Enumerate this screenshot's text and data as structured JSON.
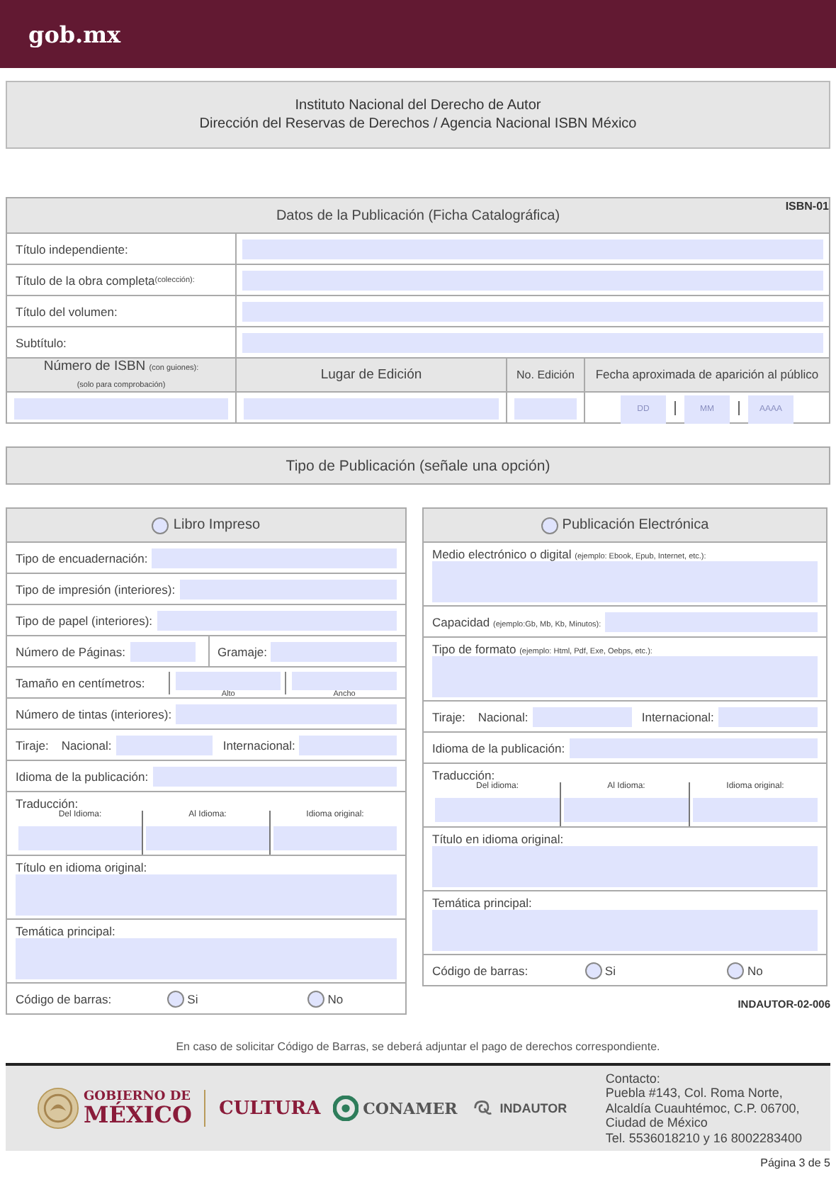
{
  "header": {
    "brand": "gob.mx"
  },
  "institution": {
    "lines": [
      "Instituto Nacional del Derecho de Autor",
      "Dirección del Reservas de Derechos / Agencia Nacional ISBN México"
    ]
  },
  "publication_data": {
    "title": "Datos de la Publicación (Ficha Catalográfica)",
    "form_code": "ISBN-01",
    "fields": [
      {
        "label": "Título independiente:"
      },
      {
        "label": "Título de la obra completa",
        "note": "(colección):"
      },
      {
        "label": "Título del volumen:"
      },
      {
        "label": "Subtítulo:"
      }
    ],
    "columns": [
      {
        "label": "Número de ISBN",
        "note": "(con guiones):",
        "subnote": "(solo para comprobación)"
      },
      {
        "label": "Lugar de Edición"
      },
      {
        "label": "No. Edición"
      },
      {
        "label": "Fecha aproximada de aparición al público"
      }
    ],
    "date_placeholders": [
      "DD",
      "MM",
      "AAAA"
    ]
  },
  "type_section": {
    "title": "Tipo de Publicación (señale una opción)"
  },
  "publication_types": [
    {
      "title": "Libro Impreso",
      "selected": false,
      "rows": [
        {
          "kind": "field",
          "label": "Tipo de encuadernación:"
        },
        {
          "kind": "field",
          "label": "Tipo de impresión (interiores):"
        },
        {
          "kind": "field",
          "label": "Tipo de papel (interiores):"
        },
        {
          "kind": "pair",
          "items": [
            "Número de Páginas:",
            "Gramaje:"
          ]
        },
        {
          "kind": "size",
          "label": "Tamaño en centímetros:",
          "items": [
            "Alto",
            "Ancho"
          ]
        },
        {
          "kind": "field",
          "label": "Número de tintas (interiores):"
        },
        {
          "kind": "multi",
          "label": "Tiraje:",
          "items": [
            "Nacional:",
            "Internacional:"
          ]
        },
        {
          "kind": "field",
          "label": "Idioma de la publicación:"
        },
        {
          "kind": "columns",
          "label": "Traducción:",
          "items": [
            "Del Idioma:",
            "Al Idioma:",
            "Idioma original:"
          ]
        },
        {
          "kind": "area",
          "label": "Título en idioma original:"
        },
        {
          "kind": "area",
          "label": "Temática principal:"
        },
        {
          "kind": "radio",
          "label": "Código de barras:",
          "options": [
            {
              "label": "Si",
              "selected": false
            },
            {
              "label": "No",
              "selected": false
            }
          ]
        }
      ]
    },
    {
      "title": "Publicación Electrónica",
      "selected": false,
      "rows": [
        {
          "kind": "area",
          "label": "Medio electrónico o digital",
          "note": "(ejemplo: Ebook, Epub, Internet, etc.):"
        },
        {
          "kind": "field",
          "label": "Capacidad",
          "note": "(ejemplo:Gb, Mb, Kb, Minutos):"
        },
        {
          "kind": "area",
          "label": "Tipo de formato",
          "note": "(ejemplo: Html, Pdf, Exe, Oebps, etc.):"
        },
        {
          "kind": "multi",
          "label": "Tiraje:",
          "items": [
            "Nacional:",
            "Internacional:"
          ]
        },
        {
          "kind": "field",
          "label": "Idioma de la publicación:"
        },
        {
          "kind": "columns",
          "label": "Traducción:",
          "items": [
            "Del idioma:",
            "Al Idioma:",
            "Idioma original:"
          ]
        },
        {
          "kind": "area",
          "label": "Título en idioma original:"
        },
        {
          "kind": "area",
          "label": "Temática principal:"
        },
        {
          "kind": "radio",
          "label": "Código de barras:",
          "options": [
            {
              "label": "Si",
              "selected": false
            },
            {
              "label": "No",
              "selected": false
            }
          ]
        }
      ]
    }
  ],
  "form_code": "INDAUTOR-02-006",
  "note": "En caso de solicitar Código de Barras, se deberá adjuntar el pago de derechos correspondiente.",
  "footer": {
    "logos": {
      "government": [
        "GOBIERNO DE",
        "MÉXICO"
      ],
      "culture": "CULTURA",
      "conamer": "CONAMER",
      "indautor": "INDAUTOR"
    },
    "contact": [
      "Contacto:",
      "Puebla #143, Col. Roma Norte,",
      "Alcaldía Cuauhtémoc, C.P. 06700,",
      "Ciudad de México",
      "Tel. 5536018210 y 16  8002283400"
    ]
  },
  "page": "Página 3 de 5"
}
